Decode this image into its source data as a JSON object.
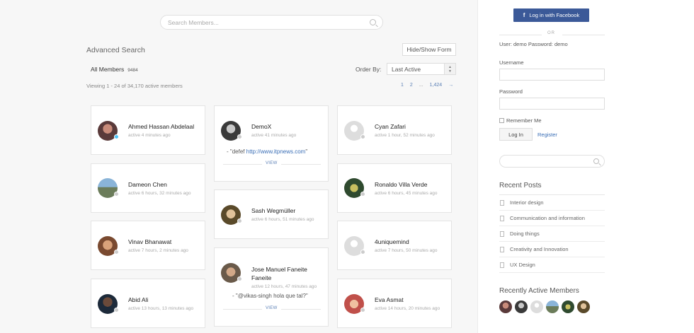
{
  "search": {
    "placeholder": "Search Members..."
  },
  "advanced_search_label": "Advanced Search",
  "hide_show_label": "Hide/Show Form",
  "all_members_label": "All Members",
  "all_members_count": "9484",
  "order_by_label": "Order By:",
  "order_by_value": "Last Active",
  "viewing_text": "Viewing 1 - 24 of 34,170 active members",
  "pagination": {
    "p1": "1",
    "p2": "2",
    "dots": "...",
    "last": "1,424",
    "next": "→"
  },
  "members": [
    {
      "name": "Ahmed Hassan Abdelaal",
      "active": "active 4 minutes ago",
      "online": true
    },
    {
      "name": "Dameon Chen",
      "active": "active 6 hours, 32 minutes ago",
      "online": false
    },
    {
      "name": "Vinav Bhanawat",
      "active": "active 7 hours, 2 minutes ago",
      "online": false
    },
    {
      "name": "Abid Ali",
      "active": "active 13 hours, 13 minutes ago",
      "online": false
    },
    {
      "name": "DemoX",
      "active": "active 41 minutes ago",
      "online": false,
      "update_prefix": "- \"defef ",
      "update_link": "http://www.itpnews.com",
      "update_suffix": "\"",
      "view": "VIEW"
    },
    {
      "name": "Sash Wegmüller",
      "active": "active 6 hours, 51 minutes ago",
      "online": false
    },
    {
      "name": "Jose Manuel Faneite",
      "name2": "Faneite",
      "active": "active 12 hours, 47 minutes ago",
      "online": false,
      "update_prefix": "- \"@vikas-singh hola que tal?\"",
      "view": "VIEW"
    },
    {
      "name": "Cyan Zafari",
      "active": "active 1 hour, 52 minutes ago",
      "online": false
    },
    {
      "name": "Ronaldo Villa Verde",
      "active": "active 6 hours, 45 minutes ago",
      "online": false
    },
    {
      "name": "4uniquemind",
      "active": "active 7 hours, 50 minutes ago",
      "online": false
    },
    {
      "name": "Eva Asmat",
      "active": "active 14 hours, 20 minutes ago",
      "online": false
    }
  ],
  "sidebar": {
    "facebook_label": "Log in with Facebook",
    "or_label": "OR",
    "demo_text": "User: demo Password: demo",
    "username_label": "Username",
    "password_label": "Password",
    "remember_label": "Remember Me",
    "login_label": "Log In",
    "register_label": "Register",
    "recent_posts_title": "Recent Posts",
    "posts": [
      "Interior design",
      "Communication and information",
      "Doing things",
      "Creativity and Innovation",
      "UX Design"
    ],
    "recent_members_title": "Recently Active Members"
  },
  "colors": {
    "accent": "#3b6fb6",
    "facebook": "#3b5998",
    "online": "#4fc3f7"
  }
}
